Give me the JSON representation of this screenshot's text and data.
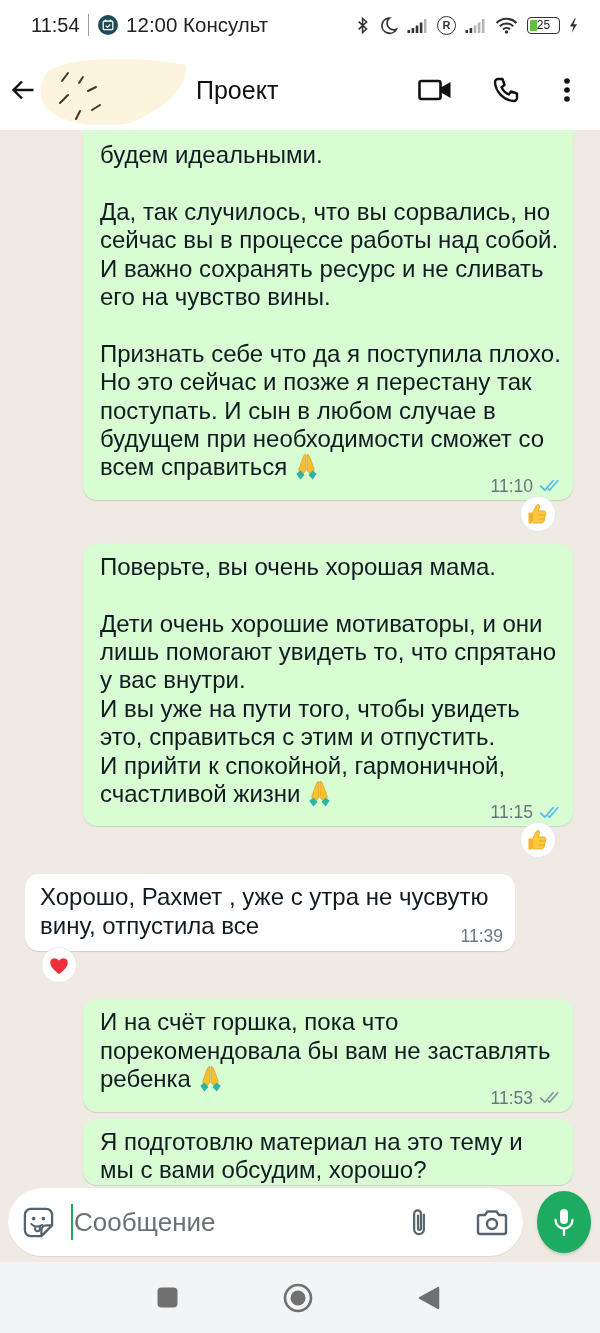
{
  "status_bar": {
    "time": "11:54",
    "notification": "12:00 Консульт",
    "roaming": "R",
    "battery": "25"
  },
  "header": {
    "title": "Проект"
  },
  "messages": [
    {
      "kind": "outgoing",
      "paragraphs": [
        [
          "будем идеальными."
        ],
        [
          "Да, так случилось, что вы сорвались, но",
          "сейчас вы в процессе работы над собой.",
          "И важно сохранять ресурс и не сливать",
          "его на чувство вины."
        ],
        [
          "Признать себе что да я поступила плохо.",
          "Но это сейчас и позже я перестану так",
          "поступать. И сын в любом случае в",
          "будущем при необходимости сможет со",
          "всем справиться"
        ]
      ],
      "trailing_emoji": true,
      "time": "11:10",
      "read": true,
      "reaction": {
        "kind": "thumbs_up"
      }
    },
    {
      "kind": "outgoing",
      "paragraphs": [
        [
          "Поверьте, вы очень хорошая мама."
        ],
        [
          "Дети очень хорошие мотиваторы, и они",
          "лишь помогают увидеть то, что спрятано",
          "у вас внутри.",
          "И вы уже на пути того, чтобы увидеть",
          "это, справиться с этим и отпустить.",
          "И прийти к спокойной, гармоничной,",
          "счастливой жизни"
        ]
      ],
      "trailing_emoji": true,
      "time": "11:15",
      "read": true,
      "reaction": {
        "kind": "thumbs_up"
      }
    },
    {
      "kind": "incoming",
      "paragraphs": [
        [
          "Хорошо, Рахмет , уже с утра не чусвутю",
          "вину, отпустила все"
        ]
      ],
      "trailing_emoji": false,
      "time": "11:39",
      "reaction": {
        "kind": "heart"
      }
    },
    {
      "kind": "outgoing",
      "paragraphs": [
        [
          "И на счёт горшка, пока что",
          "порекомендовала бы вам не заставлять",
          "ребенка"
        ]
      ],
      "trailing_emoji": true,
      "time": "11:53",
      "read": false
    },
    {
      "kind": "outgoing",
      "paragraphs": [
        [
          "Я подготовлю материал на это тему и",
          "мы с вами обсудим, хорошо?"
        ]
      ],
      "trailing_emoji": false
    }
  ],
  "composer": {
    "placeholder": "Сообщение"
  }
}
